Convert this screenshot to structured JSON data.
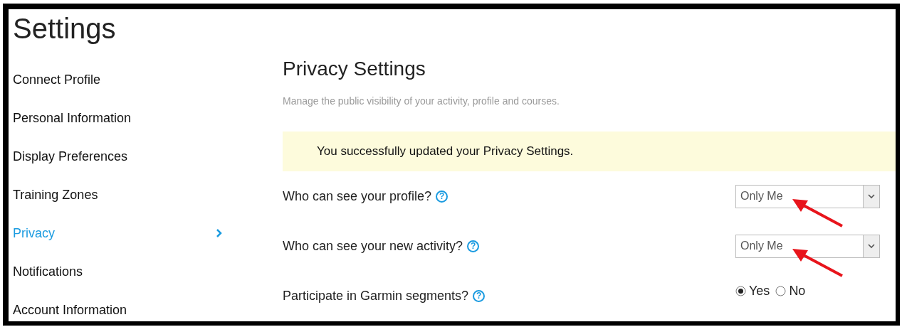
{
  "page_title": "Settings",
  "sidebar": {
    "items": [
      {
        "label": "Connect Profile",
        "selected": false
      },
      {
        "label": "Personal Information",
        "selected": false
      },
      {
        "label": "Display Preferences",
        "selected": false
      },
      {
        "label": "Training Zones",
        "selected": false
      },
      {
        "label": "Privacy",
        "selected": true
      },
      {
        "label": "Notifications",
        "selected": false
      },
      {
        "label": "Account Information",
        "selected": false
      }
    ]
  },
  "main": {
    "title": "Privacy Settings",
    "subtitle": "Manage the public visibility of your activity, profile and courses.",
    "notice": "You successfully updated your Privacy Settings.",
    "rows": [
      {
        "kind": "select",
        "label": "Who can see your profile?",
        "help": "?",
        "value": "Only Me",
        "annotated": true
      },
      {
        "kind": "select",
        "label": "Who can see your new activity?",
        "help": "?",
        "value": "Only Me",
        "annotated": true
      },
      {
        "kind": "radio",
        "label": "Participate in Garmin segments?",
        "help": "?",
        "options": [
          {
            "label": "Yes",
            "selected": true
          },
          {
            "label": "No",
            "selected": false
          }
        ]
      }
    ]
  }
}
